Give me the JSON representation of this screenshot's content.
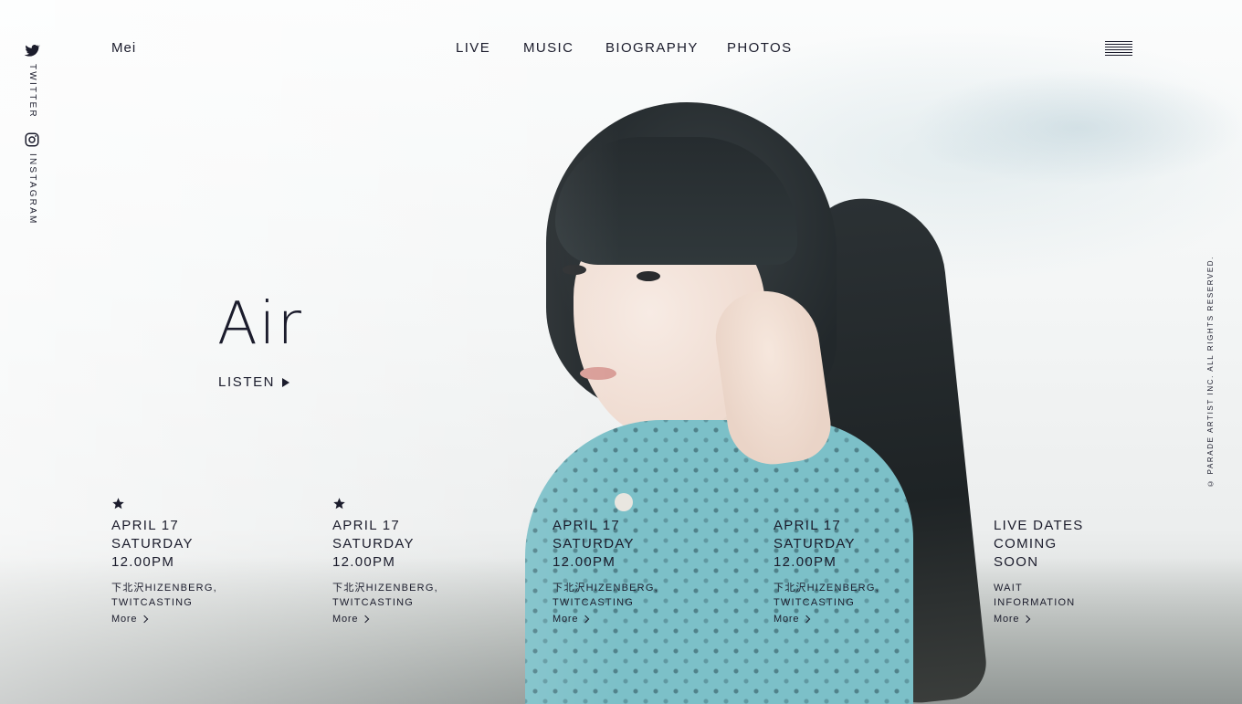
{
  "header": {
    "brand": "Mei",
    "nav": [
      "LIVE",
      "MUSIC",
      "BIOGRAPHY",
      "PHOTOS"
    ],
    "menu_icon": "hamburger-menu-icon"
  },
  "social": {
    "twitter": {
      "label": "TWITTER",
      "icon": "twitter-icon"
    },
    "instagram": {
      "label": "INSTAGRAM",
      "icon": "instagram-icon"
    }
  },
  "hero": {
    "title": "Air",
    "listen_label": "LISTEN",
    "listen_icon": "play-triangle-icon"
  },
  "copyright": "© PARADE ARTIST INC. ALL RIGHTS RESERVED.",
  "events": [
    {
      "starred": true,
      "date": "APRIL 17\nSATURDAY\n12.00PM",
      "venue": "下北沢HIZENBERG,\nTWITCASTING",
      "more": "More"
    },
    {
      "starred": true,
      "date": "APRIL 17\nSATURDAY\n12.00PM",
      "venue": "下北沢HIZENBERG,\nTWITCASTING",
      "more": "More"
    },
    {
      "starred": false,
      "date": "APRIL 17\nSATURDAY\n12.00PM",
      "venue": "下北沢HIZENBERG,\nTWITCASTING",
      "more": "More"
    },
    {
      "starred": false,
      "date": "APRIL 17\nSATURDAY\n12.00PM",
      "venue": "下北沢HIZENBERG,\nTWITCASTING",
      "more": "More"
    },
    {
      "starred": false,
      "date": "LIVE DATES\nCOMING\nSOON",
      "venue": "WAIT\nINFORMATION",
      "more": "More"
    }
  ],
  "colors": {
    "text": "#1b1c2c",
    "blouse": "#7cc0c8",
    "hair": "#262c2f"
  }
}
